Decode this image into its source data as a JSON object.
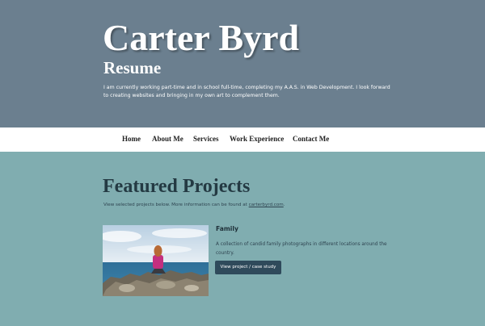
{
  "header": {
    "name": "Carter Byrd",
    "subtitle": "Resume",
    "bio": "I am currently working part-time and in school full-time, completing my A.A.S. in Web Development. I look forward to creating websites and bringing in my own art to complement them."
  },
  "nav": {
    "items": [
      "Home",
      "About Me",
      "Services",
      "Work Experience",
      "Contact Me"
    ]
  },
  "featured": {
    "title": "Featured Projects",
    "intro": "View selected projects below. More information can be found at ",
    "link_text": "carterbyrd.com",
    "intro_end": "."
  },
  "project": {
    "title": "Family",
    "description": "A collection of candid family photographs in different locations around the country.",
    "button_label": "View project / case study"
  },
  "colors": {
    "hero_bg": "#6b7f8f",
    "page_bg": "#80adb0",
    "button_bg": "#2f4a5b"
  }
}
